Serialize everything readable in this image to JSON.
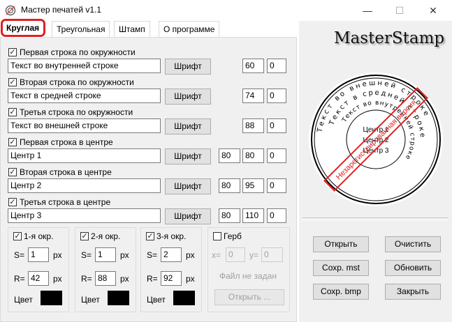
{
  "window": {
    "title": "Мастер печатей v1.1",
    "minimize": "—",
    "maximize": "☐",
    "close": "✕"
  },
  "tabs": [
    {
      "label": "Круглая"
    },
    {
      "label": "Треугольная"
    },
    {
      "label": "Штамп"
    },
    {
      "label": "О программе"
    }
  ],
  "rows": [
    {
      "check_label": "Первая строка по окружности",
      "checked": "✓",
      "text": "Текст во внутренней строке",
      "font_btn": "Шрифт",
      "v1": "",
      "v2": "60",
      "v3": "0"
    },
    {
      "check_label": "Вторая строка по окружности",
      "checked": "✓",
      "text": "Текст в средней строке",
      "font_btn": "Шрифт",
      "v1": "",
      "v2": "74",
      "v3": "0"
    },
    {
      "check_label": "Третья строка по окружности",
      "checked": "✓",
      "text": "Текст во внешней строке",
      "font_btn": "Шрифт",
      "v1": "",
      "v2": "88",
      "v3": "0"
    },
    {
      "check_label": "Первая строка в центре",
      "checked": "✓",
      "text": "Центр 1",
      "font_btn": "Шрифт",
      "v1": "80",
      "v2": "80",
      "v3": "0"
    },
    {
      "check_label": "Вторая строка в центре",
      "checked": "✓",
      "text": "Центр 2",
      "font_btn": "Шрифт",
      "v1": "80",
      "v2": "95",
      "v3": "0"
    },
    {
      "check_label": "Третья строка в центре",
      "checked": "✓",
      "text": "Центр 3",
      "font_btn": "Шрифт",
      "v1": "80",
      "v2": "110",
      "v3": "0"
    }
  ],
  "circles": [
    {
      "label": "1-я окр.",
      "s_label": "S=",
      "s": "1",
      "r_label": "R=",
      "r": "42",
      "unit": "px",
      "color_label": "Цвет"
    },
    {
      "label": "2-я окр.",
      "s_label": "S=",
      "s": "1",
      "r_label": "R=",
      "r": "88",
      "unit": "px",
      "color_label": "Цвет"
    },
    {
      "label": "3-я окр.",
      "s_label": "S=",
      "s": "2",
      "r_label": "R=",
      "r": "92",
      "unit": "px",
      "color_label": "Цвет"
    }
  ],
  "emblem": {
    "label": "Герб",
    "x_label": "x=",
    "x": "0",
    "y_label": "y=",
    "y": "0",
    "file_status": "Файл не задан",
    "open_btn": "Открыть ..."
  },
  "logo": "MasterStamp",
  "stamp": {
    "inner_text": "Текст во внутренней строке",
    "middle_text": "Текст в средней строке",
    "outer_text": "Текст во внешней строке",
    "center": [
      "Центр 1",
      "Центр 2",
      "Центр 3"
    ],
    "watermark": "Незарегистрированная версия"
  },
  "actions": {
    "open": "Открыть",
    "clear": "Очистить",
    "save_mst": "Сохр. mst",
    "refresh": "Обновить",
    "save_bmp": "Сохр. bmp",
    "close": "Закрыть"
  },
  "colors": {
    "active_tab_highlight": "#e02020",
    "stamp_ink": "#000000",
    "watermark": "#e02020"
  }
}
